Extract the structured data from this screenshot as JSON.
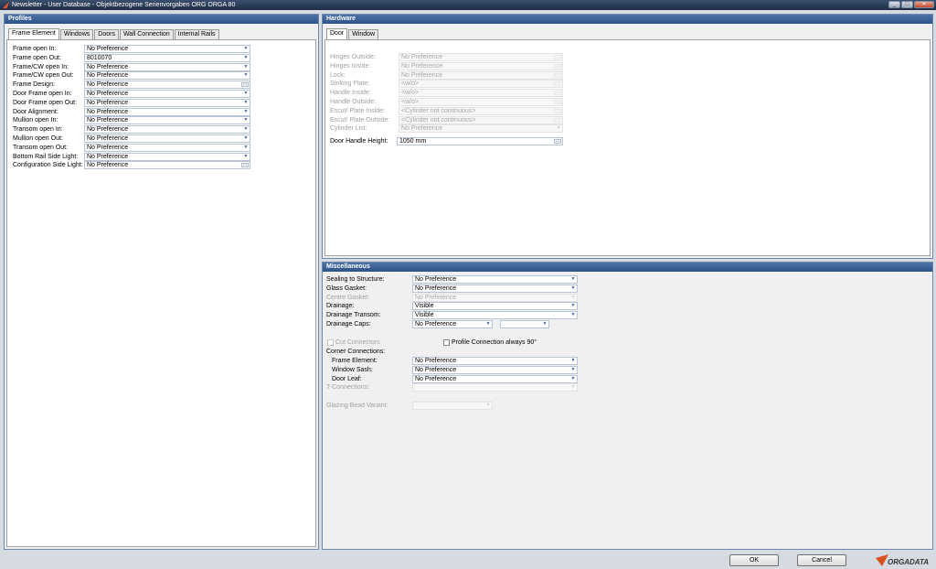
{
  "window": {
    "title": "Newsletter - User Database - Objektbezogene Serienvorgaben ORG ORGA 80",
    "min": "_",
    "max": "□",
    "close": "✕"
  },
  "profiles": {
    "title": "Profiles",
    "tabs": [
      "Frame Element",
      "Windows",
      "Doors",
      "Wall Connection",
      "Internal Rails"
    ],
    "rows": [
      {
        "label": "Frame open In:",
        "value": "No Preference",
        "control": "dd"
      },
      {
        "label": "Frame open Out:",
        "value": "8010070",
        "control": "dd"
      },
      {
        "label": "Frame/CW open In:",
        "value": "No Preference",
        "control": "dd"
      },
      {
        "label": "Frame/CW open Out:",
        "value": "No Preference",
        "control": "dd"
      },
      {
        "label": "Frame Design:",
        "value": "No Preference",
        "control": "dots"
      },
      {
        "label": "Door Frame open In:",
        "value": "No Preference",
        "control": "dd"
      },
      {
        "label": "Door Frame open Out:",
        "value": "No Preference",
        "control": "dd"
      },
      {
        "label": "Door Alignment:",
        "value": "No Preference",
        "control": "dd"
      },
      {
        "label": "Mullion open In:",
        "value": "No Preference",
        "control": "dd"
      },
      {
        "label": "Transom open In:",
        "value": "No Preference",
        "control": "dd"
      },
      {
        "label": "Mullion open Out:",
        "value": "No Preference",
        "control": "dd"
      },
      {
        "label": "Transom open Out:",
        "value": "No Preference",
        "control": "dd"
      },
      {
        "label": "Bottom Rail Side Light:",
        "value": "No Preference",
        "control": "dd"
      },
      {
        "label": "Configuration Side Light:",
        "value": "No Preference",
        "control": "dots"
      }
    ]
  },
  "hardware": {
    "title": "Hardware",
    "tabs": [
      "Door",
      "Window"
    ],
    "rows": [
      {
        "label": "Hinges Outside:",
        "value": "No Preference",
        "disabled": true
      },
      {
        "label": "Hinges Inside:",
        "value": "No Preference",
        "disabled": true
      },
      {
        "label": "Lock:",
        "value": "No Preference",
        "disabled": true
      },
      {
        "label": "Striking Plate:",
        "value": "<w/o>",
        "disabled": true
      },
      {
        "label": "Handle Inside:",
        "value": "<w/o>",
        "disabled": true
      },
      {
        "label": "Handle Outside:",
        "value": "<w/o>",
        "disabled": true
      },
      {
        "label": "Escut/ Plate Inside:",
        "value": "<Cylinder not continuous>",
        "disabled": true
      },
      {
        "label": "Escut/ Plate Outside:",
        "value": "<Cylinder not continuous>",
        "disabled": true
      },
      {
        "label": "Cylinder List:",
        "value": "No Preference",
        "disabled": true,
        "control": "dd"
      }
    ],
    "door_handle_height": {
      "label": "Door Handle Height:",
      "value": "1050 mm"
    }
  },
  "misc": {
    "title": "Miscellaneous",
    "rows": [
      {
        "label": "Sealing to Structure:",
        "value": "No Preference",
        "disabled": false
      },
      {
        "label": "Glass Gasket:",
        "value": "No Preference",
        "disabled": false
      },
      {
        "label": "Centre Gasket:",
        "value": "No Preference",
        "disabled": true
      },
      {
        "label": "Drainage:",
        "value": "Visible",
        "disabled": false
      },
      {
        "label": "Drainage Transom:",
        "value": "Visible",
        "disabled": false
      }
    ],
    "drainage_caps": {
      "label": "Drainage Caps:",
      "value": "No Preference",
      "value2": ""
    },
    "cut_connectors": "Cut Connectors",
    "profile_connection": "Profile Connection always 90°",
    "corner_connections": "Corner Connections:",
    "corner_rows": [
      {
        "label": "Frame Element:",
        "value": "No Preference"
      },
      {
        "label": "Window Sash:",
        "value": "No Preference"
      },
      {
        "label": "Door Leaf:",
        "value": "No Preference"
      }
    ],
    "t_connections": "T-Connections:",
    "glazing_bead": "Glazing Bead Variant:"
  },
  "footer": {
    "ok": "OK",
    "cancel": "Cancel",
    "brand": "ORGADATA",
    "brand_color": "#d9531e"
  }
}
